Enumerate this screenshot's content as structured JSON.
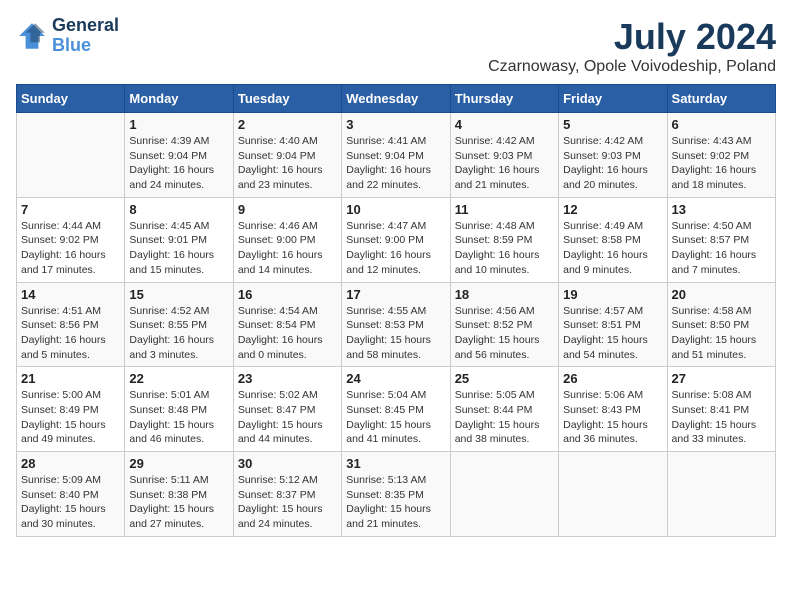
{
  "logo": {
    "line1": "General",
    "line2": "Blue"
  },
  "title": "July 2024",
  "location": "Czarnowasy, Opole Voivodeship, Poland",
  "days_of_week": [
    "Sunday",
    "Monday",
    "Tuesday",
    "Wednesday",
    "Thursday",
    "Friday",
    "Saturday"
  ],
  "weeks": [
    [
      {
        "day": "",
        "info": ""
      },
      {
        "day": "1",
        "info": "Sunrise: 4:39 AM\nSunset: 9:04 PM\nDaylight: 16 hours\nand 24 minutes."
      },
      {
        "day": "2",
        "info": "Sunrise: 4:40 AM\nSunset: 9:04 PM\nDaylight: 16 hours\nand 23 minutes."
      },
      {
        "day": "3",
        "info": "Sunrise: 4:41 AM\nSunset: 9:04 PM\nDaylight: 16 hours\nand 22 minutes."
      },
      {
        "day": "4",
        "info": "Sunrise: 4:42 AM\nSunset: 9:03 PM\nDaylight: 16 hours\nand 21 minutes."
      },
      {
        "day": "5",
        "info": "Sunrise: 4:42 AM\nSunset: 9:03 PM\nDaylight: 16 hours\nand 20 minutes."
      },
      {
        "day": "6",
        "info": "Sunrise: 4:43 AM\nSunset: 9:02 PM\nDaylight: 16 hours\nand 18 minutes."
      }
    ],
    [
      {
        "day": "7",
        "info": "Sunrise: 4:44 AM\nSunset: 9:02 PM\nDaylight: 16 hours\nand 17 minutes."
      },
      {
        "day": "8",
        "info": "Sunrise: 4:45 AM\nSunset: 9:01 PM\nDaylight: 16 hours\nand 15 minutes."
      },
      {
        "day": "9",
        "info": "Sunrise: 4:46 AM\nSunset: 9:00 PM\nDaylight: 16 hours\nand 14 minutes."
      },
      {
        "day": "10",
        "info": "Sunrise: 4:47 AM\nSunset: 9:00 PM\nDaylight: 16 hours\nand 12 minutes."
      },
      {
        "day": "11",
        "info": "Sunrise: 4:48 AM\nSunset: 8:59 PM\nDaylight: 16 hours\nand 10 minutes."
      },
      {
        "day": "12",
        "info": "Sunrise: 4:49 AM\nSunset: 8:58 PM\nDaylight: 16 hours\nand 9 minutes."
      },
      {
        "day": "13",
        "info": "Sunrise: 4:50 AM\nSunset: 8:57 PM\nDaylight: 16 hours\nand 7 minutes."
      }
    ],
    [
      {
        "day": "14",
        "info": "Sunrise: 4:51 AM\nSunset: 8:56 PM\nDaylight: 16 hours\nand 5 minutes."
      },
      {
        "day": "15",
        "info": "Sunrise: 4:52 AM\nSunset: 8:55 PM\nDaylight: 16 hours\nand 3 minutes."
      },
      {
        "day": "16",
        "info": "Sunrise: 4:54 AM\nSunset: 8:54 PM\nDaylight: 16 hours\nand 0 minutes."
      },
      {
        "day": "17",
        "info": "Sunrise: 4:55 AM\nSunset: 8:53 PM\nDaylight: 15 hours\nand 58 minutes."
      },
      {
        "day": "18",
        "info": "Sunrise: 4:56 AM\nSunset: 8:52 PM\nDaylight: 15 hours\nand 56 minutes."
      },
      {
        "day": "19",
        "info": "Sunrise: 4:57 AM\nSunset: 8:51 PM\nDaylight: 15 hours\nand 54 minutes."
      },
      {
        "day": "20",
        "info": "Sunrise: 4:58 AM\nSunset: 8:50 PM\nDaylight: 15 hours\nand 51 minutes."
      }
    ],
    [
      {
        "day": "21",
        "info": "Sunrise: 5:00 AM\nSunset: 8:49 PM\nDaylight: 15 hours\nand 49 minutes."
      },
      {
        "day": "22",
        "info": "Sunrise: 5:01 AM\nSunset: 8:48 PM\nDaylight: 15 hours\nand 46 minutes."
      },
      {
        "day": "23",
        "info": "Sunrise: 5:02 AM\nSunset: 8:47 PM\nDaylight: 15 hours\nand 44 minutes."
      },
      {
        "day": "24",
        "info": "Sunrise: 5:04 AM\nSunset: 8:45 PM\nDaylight: 15 hours\nand 41 minutes."
      },
      {
        "day": "25",
        "info": "Sunrise: 5:05 AM\nSunset: 8:44 PM\nDaylight: 15 hours\nand 38 minutes."
      },
      {
        "day": "26",
        "info": "Sunrise: 5:06 AM\nSunset: 8:43 PM\nDaylight: 15 hours\nand 36 minutes."
      },
      {
        "day": "27",
        "info": "Sunrise: 5:08 AM\nSunset: 8:41 PM\nDaylight: 15 hours\nand 33 minutes."
      }
    ],
    [
      {
        "day": "28",
        "info": "Sunrise: 5:09 AM\nSunset: 8:40 PM\nDaylight: 15 hours\nand 30 minutes."
      },
      {
        "day": "29",
        "info": "Sunrise: 5:11 AM\nSunset: 8:38 PM\nDaylight: 15 hours\nand 27 minutes."
      },
      {
        "day": "30",
        "info": "Sunrise: 5:12 AM\nSunset: 8:37 PM\nDaylight: 15 hours\nand 24 minutes."
      },
      {
        "day": "31",
        "info": "Sunrise: 5:13 AM\nSunset: 8:35 PM\nDaylight: 15 hours\nand 21 minutes."
      },
      {
        "day": "",
        "info": ""
      },
      {
        "day": "",
        "info": ""
      },
      {
        "day": "",
        "info": ""
      }
    ]
  ]
}
